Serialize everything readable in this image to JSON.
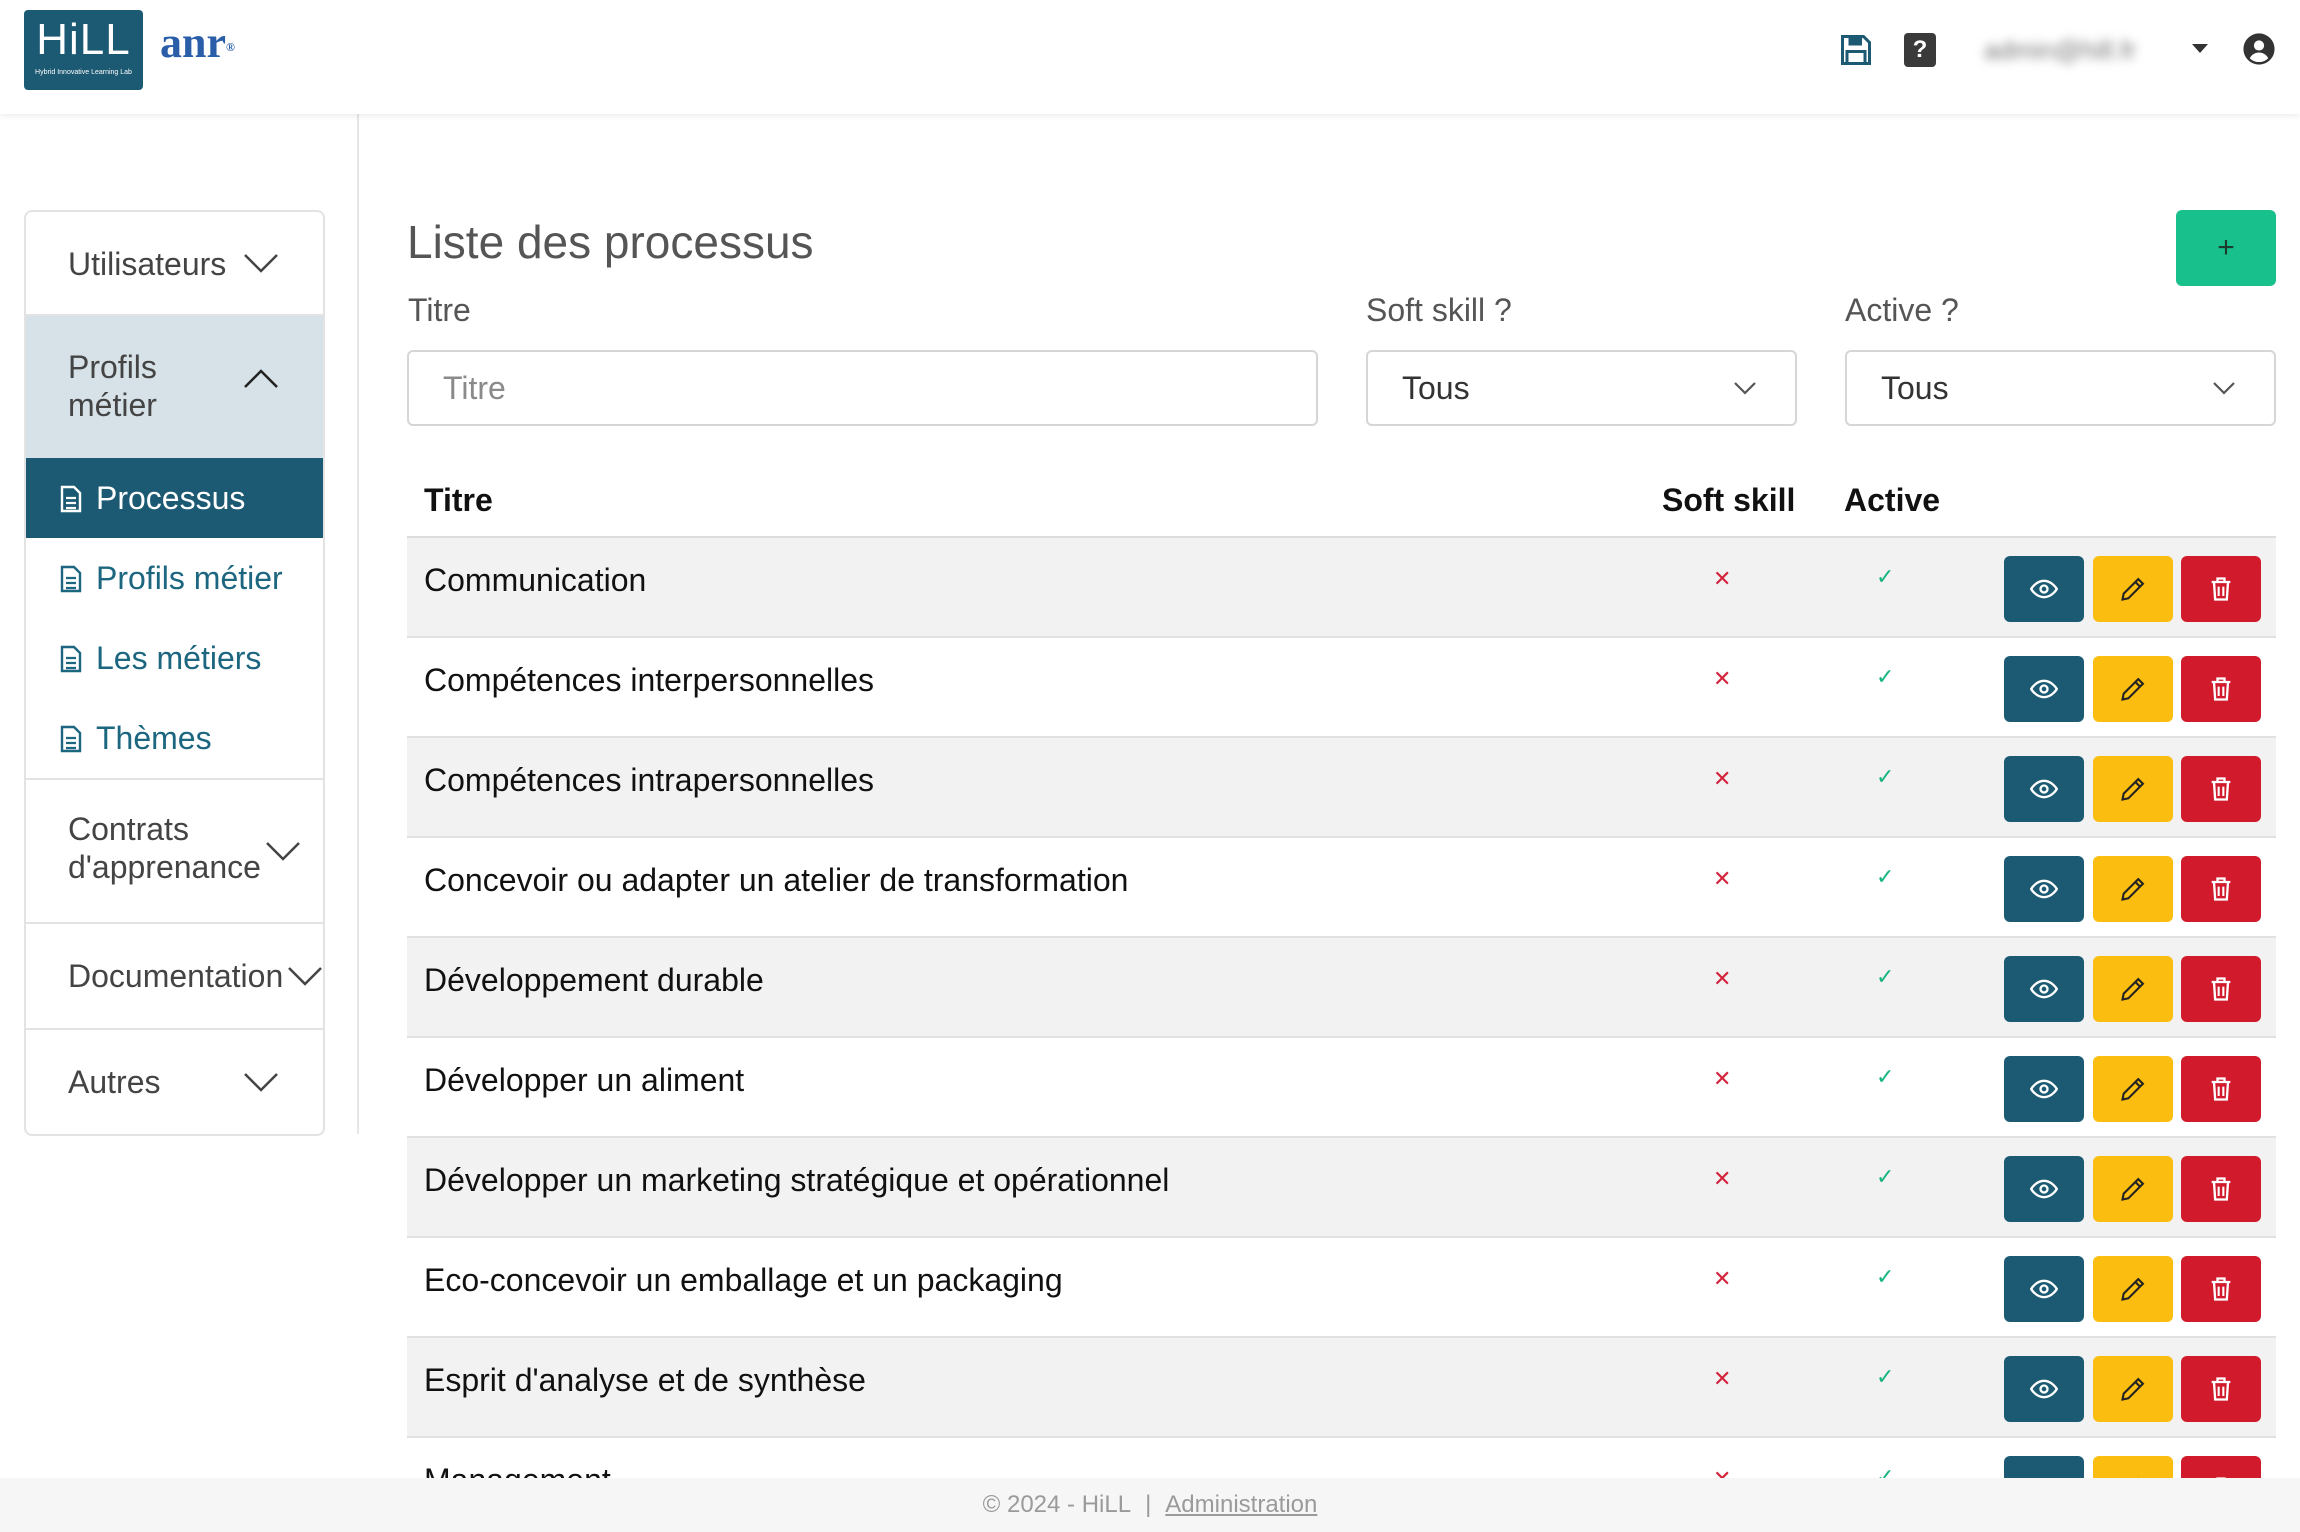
{
  "header": {
    "logo_main": "HiLL",
    "logo_sub": "Hybrid Innovative Learning Lab",
    "partner_logo": "anr",
    "partner_logo_mark": "®",
    "help_label": "?",
    "user_email": "admin@hill.fr",
    "icons": [
      "save-icon",
      "help-icon",
      "user-icon"
    ]
  },
  "sidebar": {
    "sections": {
      "users": "Utilisateurs",
      "profils": "Profils métier",
      "contrats": "Contrats d'apprenance",
      "documentation": "Documentation",
      "autres": "Autres"
    },
    "subitems": [
      {
        "label": "Processus",
        "active": true
      },
      {
        "label": "Profils métier",
        "active": false
      },
      {
        "label": "Les métiers",
        "active": false
      },
      {
        "label": "Thèmes",
        "active": false
      }
    ]
  },
  "main": {
    "title": "Liste des processus",
    "add_label": "+",
    "filters": {
      "titre_label": "Titre",
      "titre_placeholder": "Titre",
      "soft_label": "Soft skill ?",
      "soft_value": "Tous",
      "active_label": "Active ?",
      "active_value": "Tous"
    },
    "table": {
      "headers": {
        "title": "Titre",
        "soft": "Soft skill",
        "active": "Active"
      },
      "rows": [
        {
          "title": "Communication",
          "soft": "✕",
          "active": "✓"
        },
        {
          "title": "Compétences interpersonnelles",
          "soft": "✕",
          "active": "✓"
        },
        {
          "title": "Compétences intrapersonnelles",
          "soft": "✕",
          "active": "✓"
        },
        {
          "title": "Concevoir ou adapter un atelier de transformation",
          "soft": "✕",
          "active": "✓"
        },
        {
          "title": "Développement durable",
          "soft": "✕",
          "active": "✓"
        },
        {
          "title": "Développer un aliment",
          "soft": "✕",
          "active": "✓"
        },
        {
          "title": "Développer un marketing stratégique et opérationnel",
          "soft": "✕",
          "active": "✓"
        },
        {
          "title": "Eco-concevoir un emballage et un packaging",
          "soft": "✕",
          "active": "✓"
        },
        {
          "title": "Esprit d'analyse et de synthèse",
          "soft": "✕",
          "active": "✓"
        },
        {
          "title": "Management",
          "soft": "✕",
          "active": "✓"
        }
      ]
    }
  },
  "colors": {
    "primary": "#1c5a73",
    "success": "#18c08b",
    "warning": "#fbbe10",
    "danger": "#d11a2c",
    "cross": "#d3223a",
    "check": "#16b47e"
  },
  "footer": {
    "copyright": "© 2024 - HiLL",
    "separator": "|",
    "link": "Administration"
  }
}
